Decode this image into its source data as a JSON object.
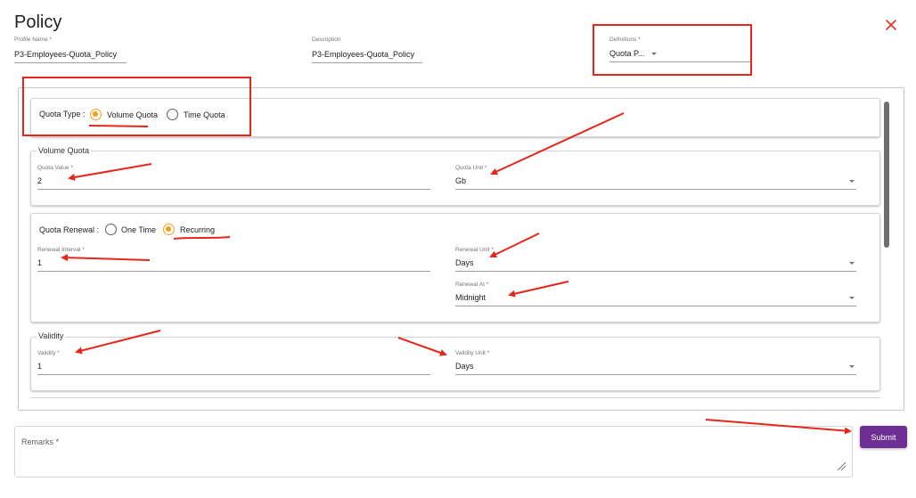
{
  "dialog": {
    "title": "Policy",
    "close_icon": "close-icon",
    "accent_color": "#f59e1b",
    "annotation_color": "#e5261b"
  },
  "header": {
    "profile_name": {
      "label": "Profile Name *",
      "value": "P3-Employees-Quota_Policy"
    },
    "description": {
      "label": "Description",
      "value": "P3-Employees-Quota_Policy"
    },
    "definitions": {
      "label": "Definitions *",
      "value": "Quota P..."
    }
  },
  "quota_type": {
    "label": "Quota Type :",
    "options": [
      "Volume Quota",
      "Time Quota"
    ],
    "selected": "Volume Quota"
  },
  "volume_quota": {
    "title": "Volume Quota",
    "quota_value": {
      "label": "Quota Value *",
      "value": "2"
    },
    "quota_unit": {
      "label": "Quota Unit *",
      "value": "Gb"
    }
  },
  "quota_renewal": {
    "label": "Quota Renewal :",
    "options": [
      "One Time",
      "Recurring"
    ],
    "selected": "Recurring",
    "renewal_interval": {
      "label": "Renewal Interval *",
      "value": "1"
    },
    "renewal_unit": {
      "label": "Renewal Unit *",
      "value": "Days"
    },
    "renewal_at": {
      "label": "Renewal At *",
      "value": "Midnight"
    }
  },
  "validity": {
    "title": "Validity",
    "validity": {
      "label": "Validity *",
      "value": "1"
    },
    "validity_unit": {
      "label": "Validity Unit *",
      "value": "Days"
    }
  },
  "footer": {
    "remarks_placeholder": "Remarks *",
    "submit_label": "Submit",
    "submit_color": "#6e2f94"
  }
}
